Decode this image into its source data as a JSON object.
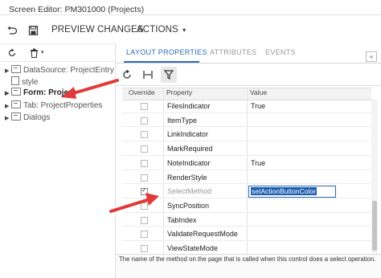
{
  "window": {
    "title": "Screen Editor: PM301000 (Projects)"
  },
  "toolbar": {
    "undo_icon": "undo-icon",
    "save_icon": "save-icon",
    "preview_label": "PREVIEW CHANGES",
    "actions_label": "ACTIONS",
    "actions_caret": "▾"
  },
  "left_panel": {
    "refresh_icon": "refresh-icon",
    "delete_icon": "trash-icon",
    "delete_caret": "▾",
    "tree": [
      {
        "label": "DataSource: ProjectEntry",
        "icon": "folder-icon",
        "expandable": true,
        "bold": false
      },
      {
        "label": "style",
        "icon": "document-icon",
        "expandable": false,
        "bold": false
      },
      {
        "label": "Form: Project",
        "icon": "folder-icon",
        "expandable": true,
        "bold": true
      },
      {
        "label": "Tab: ProjectProperties",
        "icon": "folder-icon",
        "expandable": true,
        "bold": false
      },
      {
        "label": "Dialogs",
        "icon": "folder-icon",
        "expandable": true,
        "bold": false
      }
    ]
  },
  "tabs": [
    {
      "label": "LAYOUT PROPERTIES",
      "active": true
    },
    {
      "label": "ATTRIBUTES",
      "active": false
    },
    {
      "label": "EVENTS",
      "active": false
    }
  ],
  "collapse_label": "«",
  "grid_toolbar": {
    "refresh_icon": "refresh-icon",
    "fit_icon": "fit-columns-icon",
    "filter_icon": "filter-icon"
  },
  "grid": {
    "columns": [
      "Override",
      "Property",
      "Value"
    ],
    "rows": [
      {
        "override": false,
        "property": "FilesIndicator",
        "value": "True",
        "editing": false,
        "dim": false
      },
      {
        "override": false,
        "property": "ItemType",
        "value": "",
        "editing": false,
        "dim": false
      },
      {
        "override": false,
        "property": "LinkIndicator",
        "value": "",
        "editing": false,
        "dim": false
      },
      {
        "override": false,
        "property": "MarkRequired",
        "value": "",
        "editing": false,
        "dim": false
      },
      {
        "override": false,
        "property": "NoteIndicator",
        "value": "True",
        "editing": false,
        "dim": false
      },
      {
        "override": false,
        "property": "RenderStyle",
        "value": "",
        "editing": false,
        "dim": false
      },
      {
        "override": true,
        "property": "SelectMethod",
        "value": "setActionButtonColor",
        "editing": true,
        "dim": true
      },
      {
        "override": false,
        "property": "SyncPosition",
        "value": "",
        "editing": false,
        "dim": false
      },
      {
        "override": false,
        "property": "TabIndex",
        "value": "",
        "editing": false,
        "dim": false
      },
      {
        "override": false,
        "property": "ValidateRequestMode",
        "value": "",
        "editing": false,
        "dim": false
      },
      {
        "override": false,
        "property": "ViewStateMode",
        "value": "",
        "editing": false,
        "dim": false
      }
    ]
  },
  "footer": {
    "description": "The name of the method on the page that is called when this control does a select operation."
  },
  "colors": {
    "accent": "#2a6bb3",
    "arrow": "#e03a3a",
    "selection": "#1f5fb0"
  }
}
